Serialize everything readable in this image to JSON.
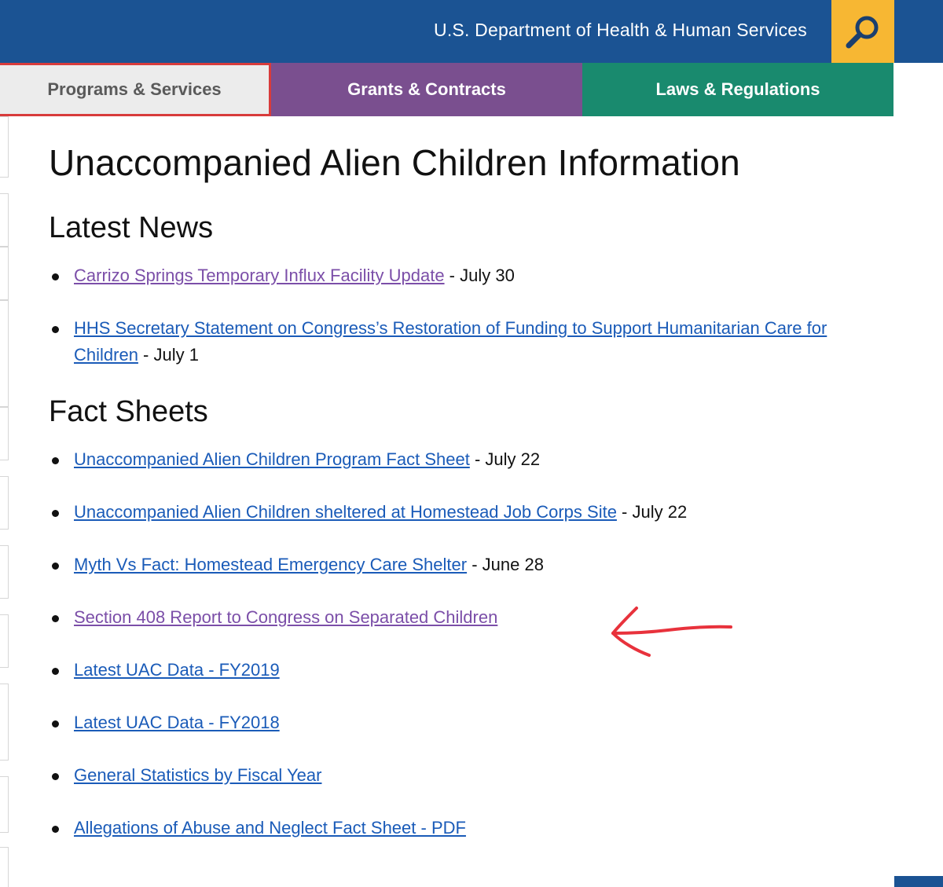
{
  "header": {
    "title": "U.S. Department of Health & Human Services",
    "search_icon": "magnifier-icon",
    "colors": {
      "bar": "#1b5393",
      "search": "#f7b733"
    }
  },
  "nav": {
    "tabs": [
      {
        "label": "Programs & Services",
        "color": "#ececec",
        "active": true
      },
      {
        "label": "Grants & Contracts",
        "color": "#7a4f8f"
      },
      {
        "label": "Laws & Regulations",
        "color": "#198a6e"
      }
    ]
  },
  "main": {
    "title": "Unaccompanied Alien Children Information",
    "latest_news": {
      "heading": "Latest News",
      "items": [
        {
          "link": "Carrizo Springs Temporary Influx Facility Update",
          "suffix": " - July 30",
          "visited": true
        },
        {
          "link": "HHS Secretary Statement on Congress’s Restoration of Funding to Support Humanitarian Care for Children",
          "suffix": " - July 1",
          "visited": false
        }
      ]
    },
    "fact_sheets": {
      "heading": "Fact Sheets",
      "items": [
        {
          "link": "Unaccompanied Alien Children Program Fact Sheet",
          "suffix": " - July 22",
          "visited": false
        },
        {
          "link": "Unaccompanied Alien Children sheltered at Homestead Job Corps Site",
          "suffix": " - July 22",
          "visited": false
        },
        {
          "link": "Myth Vs Fact: Homestead Emergency Care Shelter",
          "suffix": " - June 28",
          "visited": false
        },
        {
          "link": "Section 408 Report to Congress on Separated Children",
          "suffix": "",
          "visited": true
        },
        {
          "link": "Latest UAC Data - FY2019",
          "suffix": "",
          "visited": false
        },
        {
          "link": "Latest UAC Data - FY2018",
          "suffix": "",
          "visited": false
        },
        {
          "link": "General Statistics by Fiscal Year",
          "suffix": "",
          "visited": false
        },
        {
          "link": "Allegations of Abuse and Neglect Fact Sheet - PDF",
          "suffix": "",
          "visited": false
        }
      ]
    }
  },
  "annotation": {
    "icon": "red-arrow-icon",
    "color": "#e8323c"
  },
  "link_colors": {
    "default": "#1a5bb8",
    "visited": "#7b4ea8"
  }
}
